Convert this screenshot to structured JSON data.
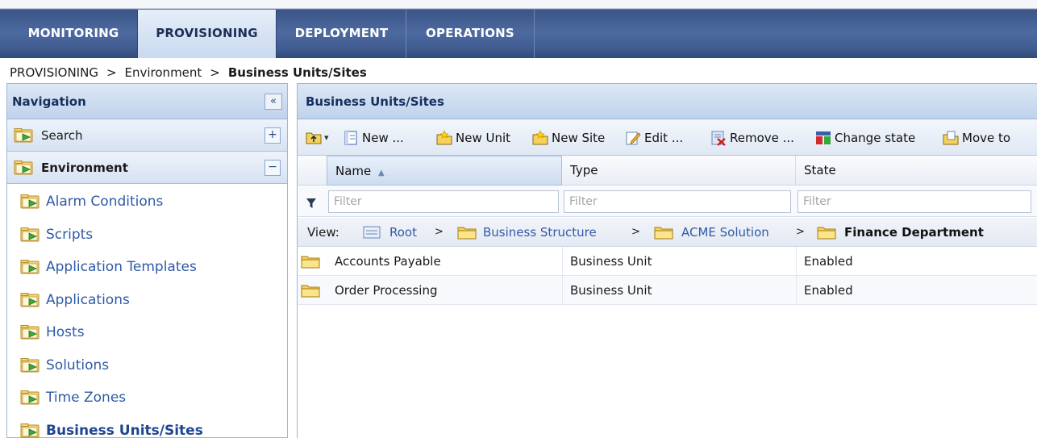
{
  "topnav": {
    "tabs": [
      {
        "label": "MONITORING"
      },
      {
        "label": "PROVISIONING"
      },
      {
        "label": "DEPLOYMENT"
      },
      {
        "label": "OPERATIONS"
      }
    ]
  },
  "breadcrumb": {
    "items": [
      "PROVISIONING",
      "Environment"
    ],
    "separator": ">",
    "current": "Business Units/Sites"
  },
  "navigation": {
    "title": "Navigation",
    "collapse_glyph": "«",
    "sections": [
      {
        "label": "Search",
        "toggle": "+"
      },
      {
        "label": "Environment",
        "toggle": "−"
      }
    ],
    "items": [
      {
        "label": "Alarm Conditions"
      },
      {
        "label": "Scripts"
      },
      {
        "label": "Application Templates"
      },
      {
        "label": "Applications"
      },
      {
        "label": "Hosts"
      },
      {
        "label": "Solutions"
      },
      {
        "label": "Time Zones"
      },
      {
        "label": "Business Units/Sites"
      }
    ]
  },
  "main": {
    "title": "Business Units/Sites",
    "toolbar": {
      "dropdown_glyph": "▾",
      "new": "New ...",
      "new_unit": "New Unit",
      "new_site": "New Site",
      "edit": "Edit ...",
      "remove": "Remove ...",
      "change_state": "Change state",
      "move_to": "Move to"
    },
    "columns": {
      "name": "Name",
      "sort_glyph": "▲",
      "type": "Type",
      "state": "State"
    },
    "filter_placeholder": "Filter",
    "view": {
      "label": "View:",
      "path": [
        "Root",
        "Business Structure",
        "ACME Solution"
      ],
      "separator": ">",
      "current": "Finance Department"
    },
    "rows": [
      {
        "name": "Accounts Payable",
        "type": "Business Unit",
        "state": "Enabled"
      },
      {
        "name": "Order Processing",
        "type": "Business Unit",
        "state": "Enabled"
      }
    ]
  },
  "colors": {
    "nav_bar": "#3f5a8f",
    "link": "#2f5aa8",
    "panel_header": "#bfd2ec"
  }
}
